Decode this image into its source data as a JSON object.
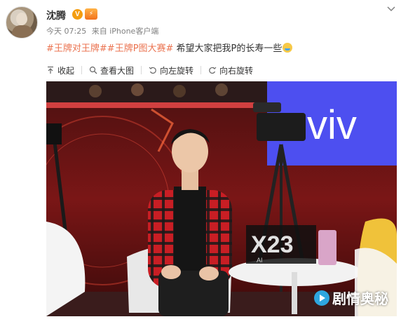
{
  "post": {
    "user_name": "沈腾",
    "verified_badge": "V",
    "level_badge": "⚡",
    "time": "今天 07:25",
    "source": "来自 iPhone客户端",
    "topic1": "#王牌对王牌#",
    "topic2": "#王牌P图大赛#",
    "text": " 希望大家把我P的长寿一些"
  },
  "toolbar": {
    "collapse": "收起",
    "view_large": "查看大图",
    "rotate_left": "向左旋转",
    "rotate_right": "向右旋转"
  },
  "photo": {
    "brand": "viv",
    "phone_model": "X23",
    "phone_tag": "AI",
    "watermark": "剧情奥秘"
  },
  "icons": {
    "menu": "chevron-down-icon",
    "collapse": "collapse-up-icon",
    "search": "search-icon",
    "rotate_left": "rotate-left-icon",
    "rotate_right": "rotate-right-icon"
  },
  "colors": {
    "topic": "#eb7350",
    "meta": "#808080",
    "verified": "#f49d0f",
    "brand_blue": "#4d4ff0"
  }
}
